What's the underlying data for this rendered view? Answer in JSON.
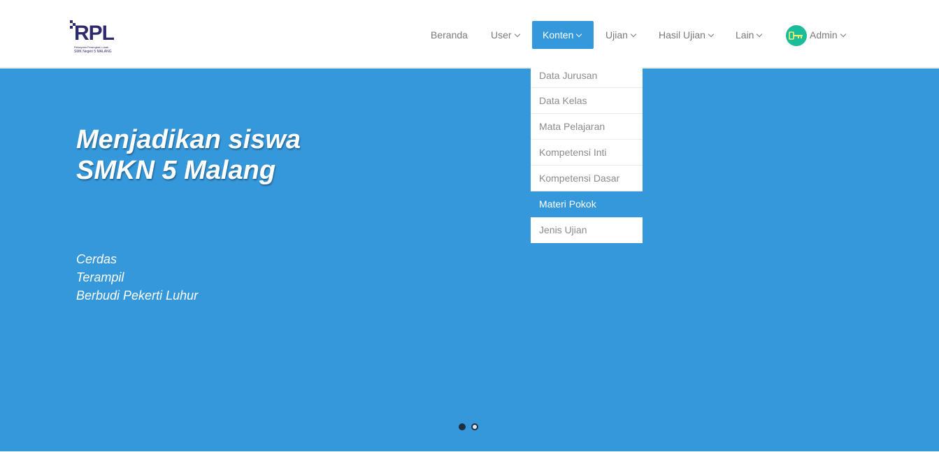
{
  "brand": {
    "logo_text": "RPL",
    "tagline": "Rekayasa Perangkat Lunak",
    "school": "SMK Negeri 5 MALANG",
    "color": "#2d2a6e"
  },
  "nav": {
    "items": [
      {
        "label": "Beranda",
        "has_dropdown": false
      },
      {
        "label": "User",
        "has_dropdown": true
      },
      {
        "label": "Konten",
        "has_dropdown": true,
        "active": true
      },
      {
        "label": "Ujian",
        "has_dropdown": true
      },
      {
        "label": "Hasil Ujian",
        "has_dropdown": true
      },
      {
        "label": "Lain",
        "has_dropdown": true
      }
    ],
    "user": {
      "label": "Admin",
      "avatar_icon": "key-icon",
      "avatar_color": "#1abc9c"
    },
    "active_color": "#3498db"
  },
  "dropdown": {
    "items": [
      {
        "label": "Data Jurusan"
      },
      {
        "label": "Data Kelas"
      },
      {
        "label": "Mata Pelajaran"
      },
      {
        "label": "Kompetensi Inti"
      },
      {
        "label": "Kompetensi Dasar"
      },
      {
        "label": "Materi Pokok",
        "highlighted": true
      },
      {
        "label": "Jenis Ujian"
      }
    ]
  },
  "hero": {
    "title_line1": "Menjadikan siswa",
    "title_line2": "SMKN 5 Malang",
    "lines": [
      "Cerdas",
      "Terampil",
      "Berbudi Pekerti Luhur"
    ],
    "background": "#3598db",
    "slides": {
      "count": 2,
      "active": 1
    }
  }
}
